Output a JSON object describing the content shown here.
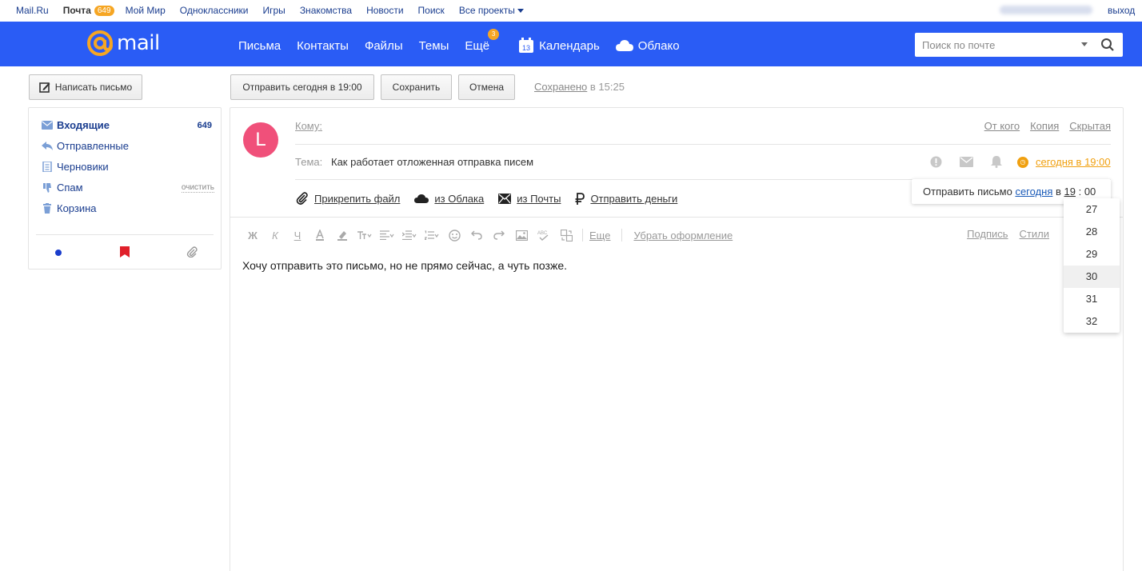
{
  "portal": {
    "links": [
      "Mail.Ru",
      "Почта",
      "Мой Мир",
      "Одноклассники",
      "Игры",
      "Знакомства",
      "Новости",
      "Поиск",
      "Все проекты"
    ],
    "mail_badge": "649",
    "logout": "выход"
  },
  "header": {
    "logo_text": "mail",
    "nav": [
      "Письма",
      "Контакты",
      "Файлы",
      "Темы",
      "Ещё"
    ],
    "more_badge": "3",
    "calendar": "Календарь",
    "calendar_day": "13",
    "cloud": "Облако",
    "search_placeholder": "Поиск по почте"
  },
  "toolbar": {
    "compose": "Написать письмо",
    "send_today": "Отправить сегодня в 19:00",
    "save": "Сохранить",
    "cancel": "Отмена",
    "saved_link": "Сохранено",
    "saved_time": " в 15:25"
  },
  "sidebar": {
    "folders": [
      {
        "label": "Входящие",
        "count": "649"
      },
      {
        "label": "Отправленные"
      },
      {
        "label": "Черновики"
      },
      {
        "label": "Спам",
        "action": "очистить"
      },
      {
        "label": "Корзина"
      }
    ]
  },
  "compose": {
    "avatar_letter": "L",
    "to_label": "Кому:",
    "from": "От кого",
    "cc": "Копия",
    "bcc": "Скрытая",
    "subject_label": "Тема:",
    "subject": "Как работает отложенная отправка писем",
    "schedule_link": "сегодня в 19:00",
    "attach": [
      "Прикрепить файл",
      "из Облака",
      "из Почты",
      "Отправить деньги"
    ],
    "format_buttons": [
      "Ж",
      "К",
      "Ч"
    ],
    "more_format": "Еще",
    "clear_format": "Убрать оформление",
    "signature": "Подпись",
    "styles": "Стили",
    "body": "Хочу отправить это письмо, но не прямо сейчас, а чуть позже."
  },
  "schedule_popup": {
    "text": "Отправить письмо ",
    "day": "сегодня",
    "in": " в ",
    "hour": "19",
    "colon": " : ",
    "minute": "00",
    "minute_options": [
      "27",
      "28",
      "29",
      "30",
      "31",
      "32"
    ],
    "highlighted": "30"
  },
  "colors": {
    "header_blue": "#2a5cf5",
    "badge_orange": "#f6a623",
    "avatar_pink": "#f0507a",
    "schedule_orange": "#f0a010",
    "link_blue": "#1a3d8f"
  }
}
